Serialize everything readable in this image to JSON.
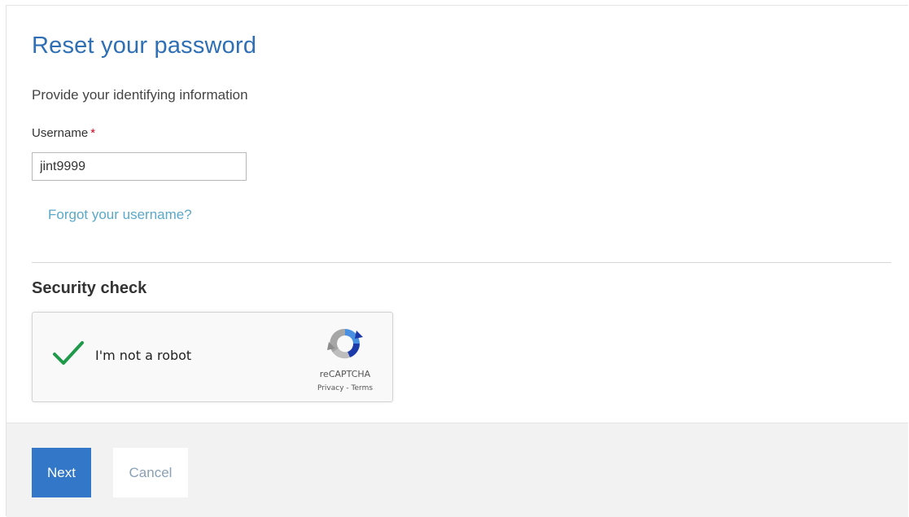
{
  "page": {
    "title": "Reset your password",
    "subtitle": "Provide your identifying information"
  },
  "form": {
    "username_label": "Username",
    "required_marker": "*",
    "username_value": "jint9999",
    "forgot_link": "Forgot your username?"
  },
  "security": {
    "title": "Security check",
    "captcha_label": "I'm not a robot",
    "captcha_brand": "reCAPTCHA",
    "privacy_link": "Privacy",
    "links_separator": " - ",
    "terms_link": "Terms",
    "checked": true,
    "check_color": "#1e9a4a"
  },
  "footer": {
    "next_label": "Next",
    "cancel_label": "Cancel"
  },
  "colors": {
    "title": "#2e6fb5",
    "link": "#5aa9c9",
    "primary_button": "#3378c8",
    "required": "#d0021b",
    "footer_bg": "#f2f2f2"
  },
  "icons": {
    "captcha_check": "checkmark-icon",
    "recaptcha_logo": "recaptcha-logo-icon"
  }
}
